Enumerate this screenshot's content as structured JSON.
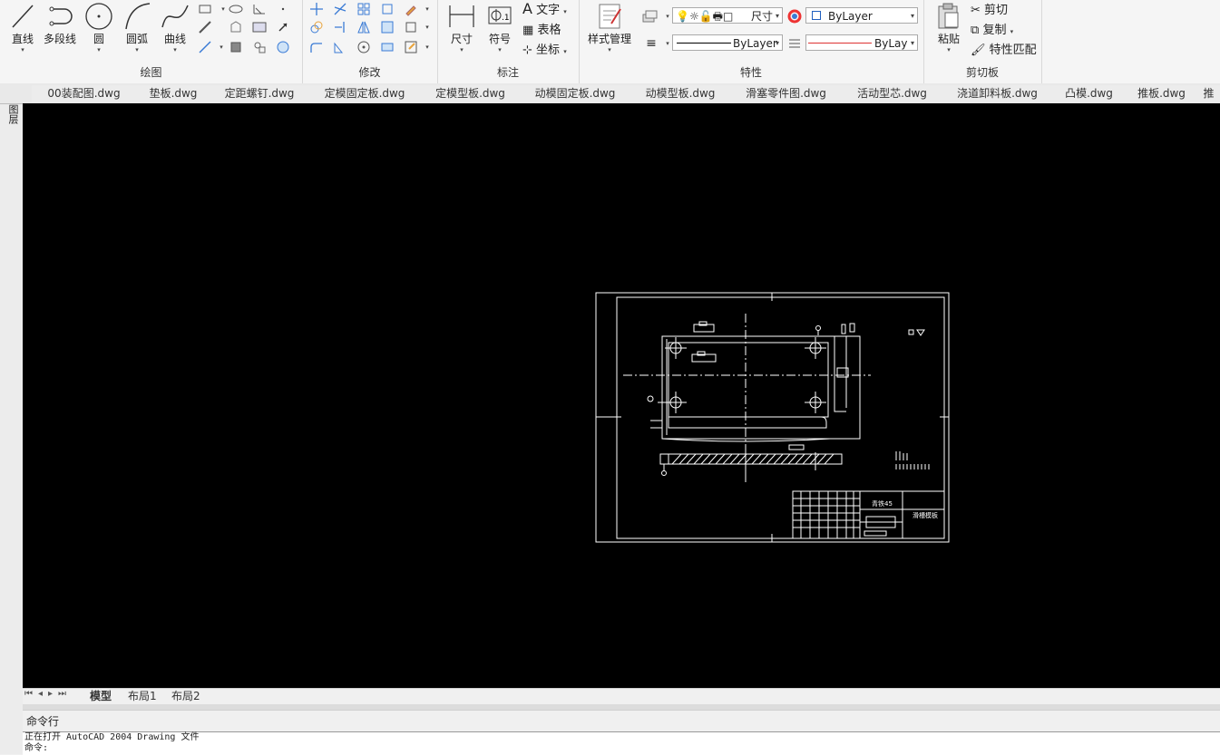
{
  "ribbon": {
    "draw": {
      "label": "绘图",
      "tools": {
        "line": "直线",
        "polyline": "多段线",
        "circle": "圆",
        "arc": "圆弧",
        "curve": "曲线"
      }
    },
    "modify": {
      "label": "修改"
    },
    "annotate": {
      "label": "标注",
      "dimension": "尺寸",
      "symbol": "符号",
      "text": "文字",
      "table": "表格",
      "coordinate": "坐标"
    },
    "properties": {
      "label": "特性",
      "style_manager": "样式管理",
      "layer_value": "尺寸",
      "color_value": "ByLayer",
      "linetype_value": "ByLayer",
      "lineweight_value": "ByLay"
    },
    "clipboard": {
      "label": "剪切板",
      "paste": "粘贴",
      "cut": "剪切",
      "copy": "复制",
      "match_props": "特性匹配"
    }
  },
  "side_panel_label": "图层",
  "file_tabs": [
    "00装配图.dwg",
    "垫板.dwg",
    "定距螺钉.dwg",
    "定模固定板.dwg",
    "定模型板.dwg",
    "动模固定板.dwg",
    "动模型板.dwg",
    "滑塞零件图.dwg",
    "活动型芯.dwg",
    "浇道卸料板.dwg",
    "凸模.dwg",
    "推板.dwg",
    "推"
  ],
  "drawing": {
    "title_block_text_1": "青铁45",
    "title_block_text_2": "滑槽模板"
  },
  "layout_tabs": [
    "模型",
    "布局1",
    "布局2"
  ],
  "command": {
    "header": "命令行",
    "lines": [
      "正在打开 AutoCAD 2004 Drawing 文件",
      "命令:"
    ]
  },
  "colors": {
    "canvas_bg": "#000000",
    "ribbon_bg": "#f5f5f5",
    "accent_blue": "#1f5fbf"
  }
}
